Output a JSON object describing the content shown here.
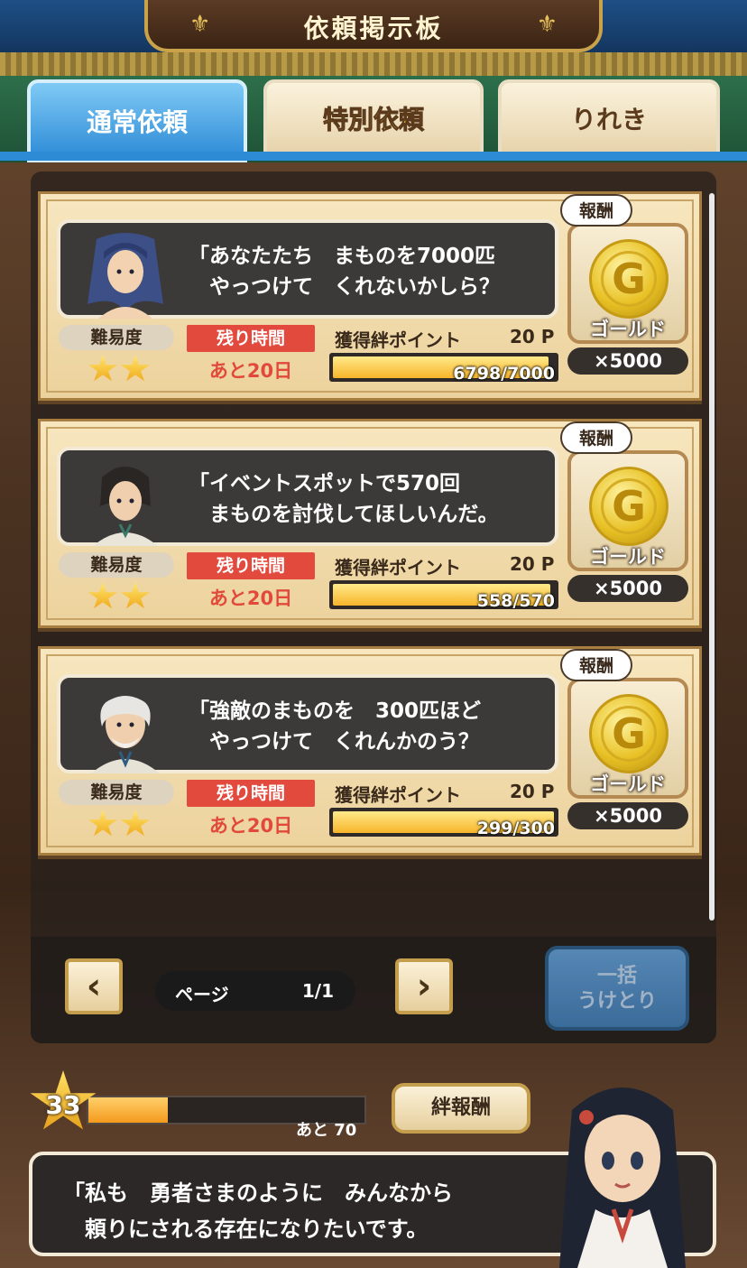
{
  "header": {
    "title": "依頼掲示板"
  },
  "tabs": [
    {
      "label": "通常依頼",
      "active": true
    },
    {
      "label": "特別依頼",
      "active": false
    },
    {
      "label": "りれき",
      "active": false
    }
  ],
  "requests": [
    {
      "message": "「あなたたち　まものを7000匹\n　やっつけて　くれないかしら？",
      "difficulty_label": "難易度",
      "difficulty_stars": 2,
      "time_label": "残り時間",
      "time_value": "あと20日",
      "points_label": "獲得絆ポイント",
      "points_value": "20 P",
      "progress_text": "6798/7000",
      "progress_fraction": 0.971,
      "reward_bubble": "報酬",
      "reward_name": "ゴールド",
      "reward_qty": "×5000"
    },
    {
      "message": "「イベントスポットで570回\n　まものを討伐してほしいんだ。",
      "difficulty_label": "難易度",
      "difficulty_stars": 2,
      "time_label": "残り時間",
      "time_value": "あと20日",
      "points_label": "獲得絆ポイント",
      "points_value": "20 P",
      "progress_text": "558/570",
      "progress_fraction": 0.979,
      "reward_bubble": "報酬",
      "reward_name": "ゴールド",
      "reward_qty": "×5000"
    },
    {
      "message": "「強敵のまものを　300匹ほど\n　やっつけて　くれんかのう？",
      "difficulty_label": "難易度",
      "difficulty_stars": 2,
      "time_label": "残り時間",
      "time_value": "あと20日",
      "points_label": "獲得絆ポイント",
      "points_value": "20 P",
      "progress_text": "299/300",
      "progress_fraction": 0.997,
      "reward_bubble": "報酬",
      "reward_name": "ゴールド",
      "reward_qty": "×5000"
    }
  ],
  "pager": {
    "label": "ページ",
    "value": "1/1"
  },
  "bulk_button": {
    "line1": "一括",
    "line2": "うけとり"
  },
  "level": {
    "value": "33",
    "remaining": "あと 70",
    "fill_fraction": 0.29
  },
  "bond_button": {
    "label": "絆報酬"
  },
  "dialog": {
    "text": "「私も　勇者さまのように　みんなから\n　頼りにされる存在になりたいです。"
  },
  "colors": {
    "tab_active": "#2c8ad6",
    "time_red": "#e24a3e",
    "bar_fill": "#f7b52a",
    "gold": "#e8c125"
  }
}
